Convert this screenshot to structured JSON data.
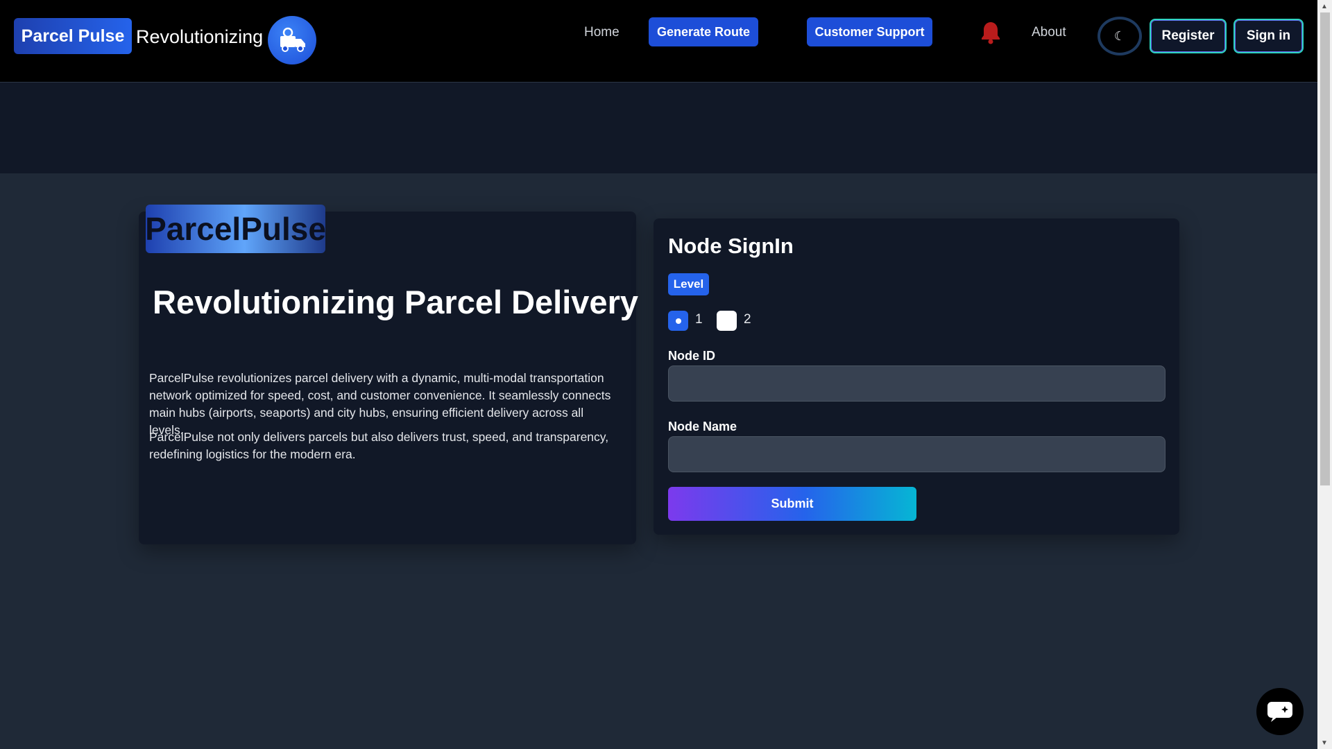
{
  "header": {
    "brand": "Parcel Pulse",
    "tagline": "Revolutionizing",
    "nav": {
      "home": "Home",
      "generate_route": "Generate Route",
      "customer_support": "Customer Support",
      "about": "About",
      "register": "Register",
      "sign_in": "Sign in"
    },
    "icons": {
      "logo": "delivery-truck-icon",
      "notifications": "bell-icon",
      "theme": "moon-icon",
      "chat": "chat-icon"
    }
  },
  "hero": {
    "badge": "ParcelPulse",
    "title": "Revolutionizing Parcel Delivery",
    "paragraph_1": "ParcelPulse revolutionizes parcel delivery with a dynamic, multi-modal transportation network optimized for speed, cost, and customer convenience. It seamlessly connects main hubs (airports, seaports) and city hubs, ensuring efficient delivery across all levels.",
    "paragraph_2": "ParcelPulse not only delivers parcels but also delivers trust, speed, and transparency, redefining logistics for the modern era."
  },
  "form": {
    "title": "Node SignIn",
    "level_label": "Level",
    "level_options": [
      "1",
      "2"
    ],
    "selected_level": "1",
    "node_id_label": "Node ID",
    "node_id_value": "",
    "node_name_label": "Node Name",
    "node_name_value": "",
    "submit": "Submit"
  },
  "colors": {
    "accent": "#2563eb",
    "page_bg": "#1f2937",
    "card_bg": "#111827",
    "bell": "#b91c1c"
  }
}
